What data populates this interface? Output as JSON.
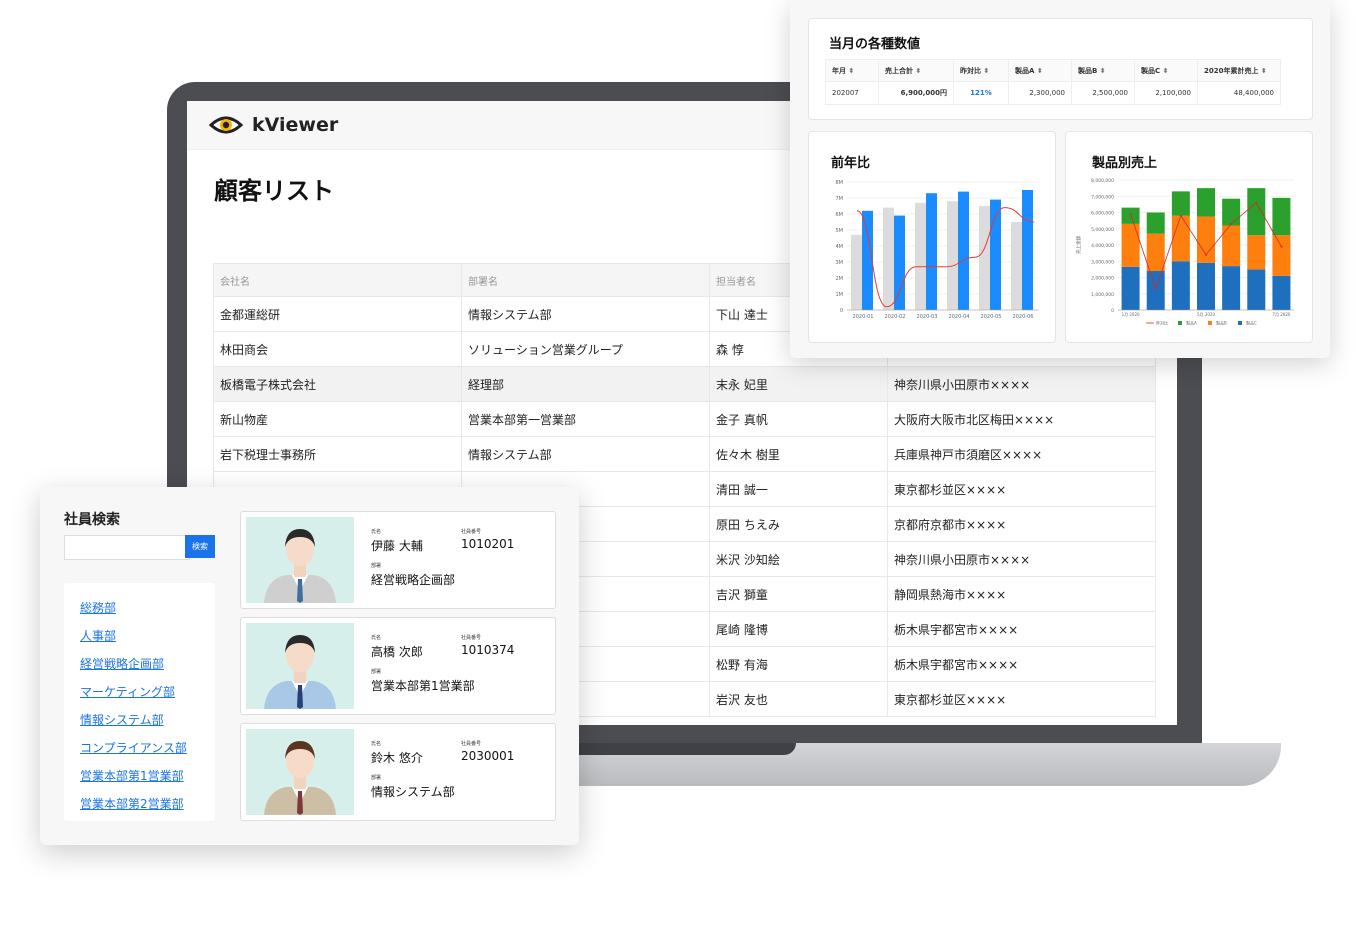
{
  "app": {
    "name": "kViewer"
  },
  "customer_list": {
    "title": "顧客リスト",
    "columns": [
      "会社名",
      "部署名",
      "担当者名",
      ""
    ],
    "rows": [
      [
        "金都運総研",
        "情報システム部",
        "下山 達士",
        ""
      ],
      [
        "林田商会",
        "ソリューション営業グループ",
        "森 惇",
        ""
      ],
      [
        "板橋電子株式会社",
        "経理部",
        "末永 妃里",
        "神奈川県小田原市××××"
      ],
      [
        "新山物産",
        "営業本部第一営業部",
        "金子 真帆",
        "大阪府大阪市北区梅田××××"
      ],
      [
        "岩下税理士事務所",
        "情報システム部",
        "佐々木 樹里",
        "兵庫県神戸市須磨区××××"
      ],
      [
        "",
        "",
        "清田 誠一",
        "東京都杉並区××××"
      ],
      [
        "",
        "",
        "原田 ちえみ",
        "京都府京都市××××"
      ],
      [
        "",
        "",
        "米沢 沙知絵",
        "神奈川県小田原市××××"
      ],
      [
        "",
        "",
        "吉沢 獅童",
        "静岡県熱海市××××"
      ],
      [
        "",
        "",
        "尾崎 隆博",
        "栃木県宇都宮市××××"
      ],
      [
        "",
        "",
        "松野 有海",
        "栃木県宇都宮市××××"
      ],
      [
        "",
        "",
        "岩沢 友也",
        "東京都杉並区××××"
      ]
    ],
    "highlight_row": 2
  },
  "stats": {
    "title": "当月の各種数値",
    "kpi_columns": [
      "年月",
      "売上合計",
      "昨対比",
      "製品A",
      "製品B",
      "製品C",
      "2020年累計売上"
    ],
    "kpi_row": [
      "202007",
      "6,900,000円",
      "121%",
      "2,300,000",
      "2,500,000",
      "2,100,000",
      "48,400,000"
    ],
    "sort_icon": "sort-icon",
    "accent": "#1a73e8"
  },
  "chart_data": [
    {
      "type": "bar",
      "title": "前年比",
      "categories": [
        "2020-01",
        "2020-02",
        "2020-03",
        "2020-04",
        "2020-05",
        "2020-06"
      ],
      "y_ticks": [
        "0",
        "1M",
        "2M",
        "3M",
        "4M",
        "5M",
        "6M",
        "7M",
        "8M"
      ],
      "ylim": [
        0,
        8
      ],
      "series": [
        {
          "values": [
            4.7,
            6.4,
            6.7,
            6.8,
            6.5,
            5.5
          ],
          "color": "#dcdcdc"
        },
        {
          "values": [
            6.2,
            5.9,
            7.3,
            7.4,
            6.9,
            7.5
          ],
          "color": "#1a8cff"
        }
      ],
      "line": {
        "values": [
          6.2,
          0.2,
          2.7,
          2.7,
          3.3,
          6.4,
          5.5
        ],
        "color": "#e53935"
      }
    },
    {
      "type": "bar",
      "title": "製品別売上",
      "stacked": true,
      "categories_count": 7,
      "x_labels": [
        "1月 2020",
        "",
        "",
        "5月 2020",
        "",
        "",
        "7月 2020"
      ],
      "y_ticks": [
        "0",
        "1,000,000",
        "2,000,000",
        "3,000,000",
        "4,000,000",
        "5,000,000",
        "6,000,000",
        "7,000,000",
        "8,000,000"
      ],
      "ylim": [
        0,
        8000000
      ],
      "ylabel": "売上金額",
      "series": [
        {
          "name": "製品C",
          "values": [
            2650000,
            2400000,
            3000000,
            2900000,
            2700000,
            2500000,
            2100000
          ],
          "color": "#1f6fbf"
        },
        {
          "name": "製品B",
          "values": [
            2650000,
            2300000,
            2800000,
            2850000,
            2500000,
            2100000,
            2500000
          ],
          "color": "#ff7f0e"
        },
        {
          "name": "製品A",
          "values": [
            1000000,
            1300000,
            1500000,
            1750000,
            1650000,
            2900000,
            2300000
          ],
          "color": "#2ca02c"
        }
      ],
      "line": {
        "name": "昨対比",
        "values": [
          5900000,
          1300000,
          5800000,
          3400000,
          5300000,
          6600000,
          3900000
        ],
        "color": "#d62728"
      },
      "legend": [
        "昨対比",
        "製品A",
        "製品B",
        "製品C"
      ]
    }
  ],
  "employee_search": {
    "title": "社員検索",
    "search_button": "検索",
    "search_value": "",
    "departments": [
      "総務部",
      "人事部",
      "経営戦略企画部",
      "マーケティング部",
      "情報システム部",
      "コンプライアンス部",
      "営業本部第1営業部",
      "営業本部第2営業部"
    ],
    "labels": {
      "name": "氏名",
      "number": "社員番号",
      "department": "部署"
    },
    "employees": [
      {
        "name": "伊藤 大輔",
        "number": "1010201",
        "department": "経営戦略企画部",
        "suit": "#cfcfcf",
        "tie": "#3f6f9a",
        "hair": "#2a2a2a"
      },
      {
        "name": "高橋 次郎",
        "number": "1010374",
        "department": "営業本部第1営業部",
        "suit": "#a9c7e6",
        "tie": "#2a3f7a",
        "hair": "#2a2a2a"
      },
      {
        "name": "鈴木 悠介",
        "number": "2030001",
        "department": "情報システム部",
        "suit": "#cdbfa6",
        "tie": "#7a3a3a",
        "hair": "#5a3620"
      }
    ]
  }
}
